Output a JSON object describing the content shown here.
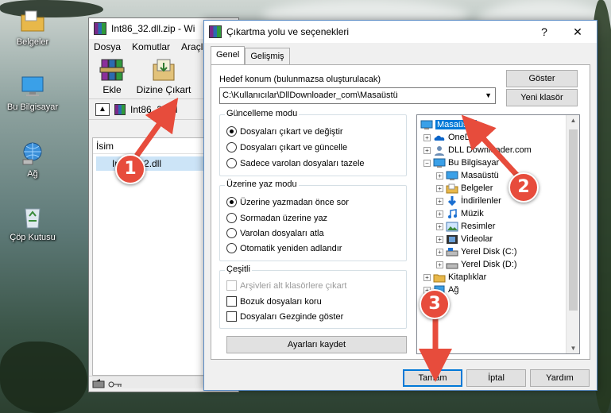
{
  "desktop": {
    "icons": [
      {
        "label": "Belgeler",
        "icon": "folder-icon"
      },
      {
        "label": "Bu Bilgisayar",
        "icon": "computer-icon"
      },
      {
        "label": "Ağ",
        "icon": "network-icon"
      },
      {
        "label": "Çöp Kutusu",
        "icon": "recycle-bin-icon"
      }
    ]
  },
  "winrar": {
    "title": "Int86_32.dll.zip - Wi",
    "menu": [
      "Dosya",
      "Komutlar",
      "Araçla"
    ],
    "toolbar": [
      "Ekle",
      "Dizine Çıkart"
    ],
    "path": "Int86_32.dl",
    "list_header": "İsim",
    "list_item": "Int86_32.dll"
  },
  "dialog": {
    "title": "Çıkartma yolu ve seçenekleri",
    "help_glyph": "?",
    "close_glyph": "✕",
    "tabs": [
      "Genel",
      "Gelişmiş"
    ],
    "target_label": "Hedef konum (bulunmazsa oluşturulacak)",
    "target_value": "C:\\Kullanıcılar\\DllDownloader_com\\Masaüstü",
    "show_button": "Göster",
    "new_folder_button": "Yeni klasör",
    "update_mode": {
      "title": "Güncelleme modu",
      "options": [
        "Dosyaları çıkart ve değiştir",
        "Dosyaları çıkart ve güncelle",
        "Sadece varolan dosyaları tazele"
      ],
      "selected": 0
    },
    "overwrite_mode": {
      "title": "Üzerine yaz modu",
      "options": [
        "Üzerine yazmadan önce sor",
        "Sormadan üzerine yaz",
        "Varolan dosyaları atla",
        "Otomatik yeniden adlandır"
      ],
      "selected": 0
    },
    "misc": {
      "title": "Çeşitli",
      "options": [
        {
          "label": "Arşivleri alt klasörlere çıkart",
          "checked": false,
          "disabled": true
        },
        {
          "label": "Bozuk dosyaları koru",
          "checked": false,
          "disabled": false
        },
        {
          "label": "Dosyaları Gezginde göster",
          "checked": false,
          "disabled": false
        }
      ]
    },
    "save_settings_button": "Ayarları kaydet",
    "tree": [
      {
        "label": "Masaüstü",
        "icon": "desktop-icon",
        "selected": true
      },
      {
        "label": "OneDri",
        "icon": "onedrive-icon"
      },
      {
        "label": "DLL Downloader.com",
        "icon": "user-icon"
      },
      {
        "label": "Bu Bilgisayar",
        "icon": "computer-icon"
      },
      {
        "label": "Masaüstü",
        "icon": "desktop-icon"
      },
      {
        "label": "Belgeler",
        "icon": "documents-icon"
      },
      {
        "label": "İndirilenler",
        "icon": "downloads-icon"
      },
      {
        "label": "Müzik",
        "icon": "music-icon"
      },
      {
        "label": "Resimler",
        "icon": "pictures-icon"
      },
      {
        "label": "Videolar",
        "icon": "videos-icon"
      },
      {
        "label": "Yerel Disk (C:)",
        "icon": "disk-icon"
      },
      {
        "label": "Yerel Disk (D:)",
        "icon": "disk-icon"
      },
      {
        "label": "Kitaplıklar",
        "icon": "libraries-icon"
      },
      {
        "label": "Ağ",
        "icon": "network-icon"
      }
    ],
    "ok_button": "Tamam",
    "cancel_button": "İptal",
    "help_button": "Yardım"
  },
  "annotations": [
    "1",
    "2",
    "3"
  ],
  "colors": {
    "badge": "#e74c3c",
    "selection": "#0078d7"
  }
}
